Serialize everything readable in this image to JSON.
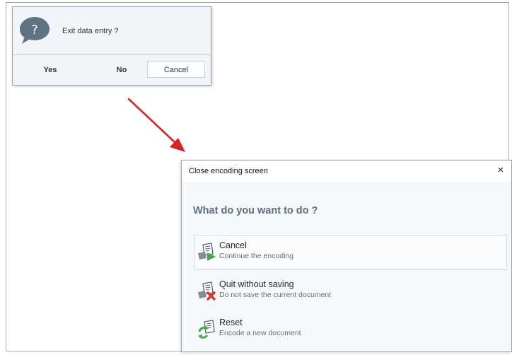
{
  "confirm_dialog": {
    "message": "Exit data entry ?",
    "yes_label": "Yes",
    "no_label": "No",
    "cancel_label": "Cancel",
    "icon": "question-bubble-icon"
  },
  "encoding_dialog": {
    "title": "Close encoding screen",
    "close_icon": "×",
    "heading": "What do you want to do ?",
    "options": [
      {
        "title": "Cancel",
        "subtitle": "Continue the encoding",
        "icon": "document-play-icon",
        "selected": true
      },
      {
        "title": "Quit without saving",
        "subtitle": "Do not save the current document",
        "icon": "document-delete-icon",
        "selected": false
      },
      {
        "title": "Reset",
        "subtitle": "Encode a new document",
        "icon": "document-refresh-icon",
        "selected": false
      }
    ]
  },
  "colors": {
    "accent": "#5c6d7d",
    "arrow": "#d92424",
    "play_green": "#3fae3f",
    "delete_red": "#d8342b"
  }
}
